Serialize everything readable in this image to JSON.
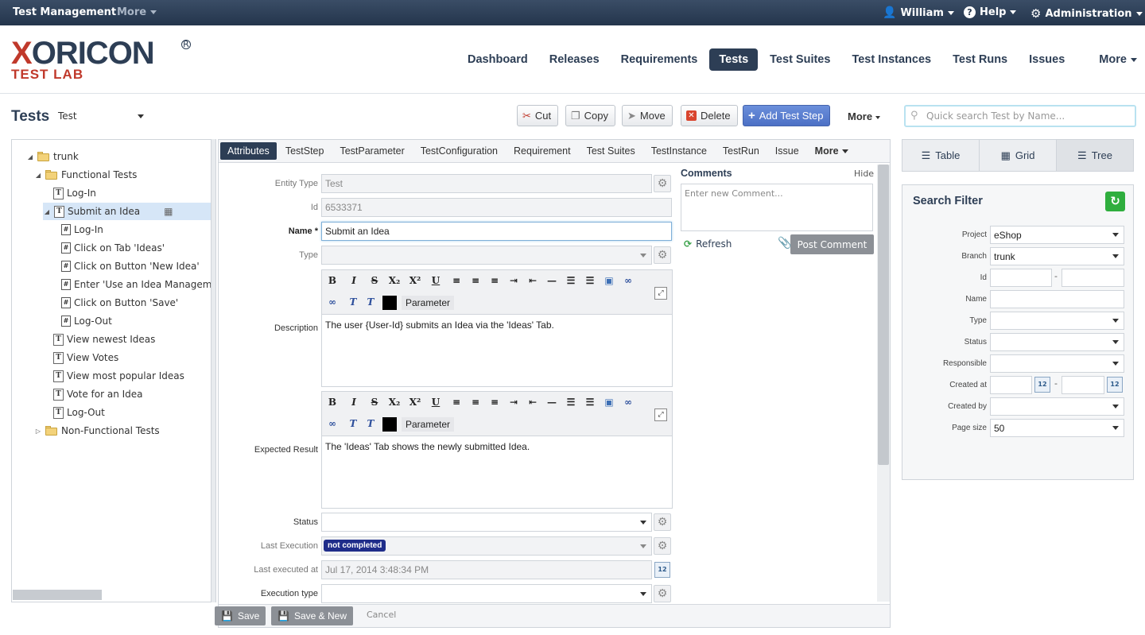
{
  "topbar": {
    "app_title": "Test Management",
    "more": "More",
    "user": "William",
    "help": "Help",
    "admin": "Administration"
  },
  "logo": {
    "line1": "XORICON",
    "line2": "TEST LAB"
  },
  "mainnav": [
    "Dashboard",
    "Releases",
    "Requirements",
    "Tests",
    "Test Suites",
    "Test Instances",
    "Test Runs",
    "Issues",
    "More"
  ],
  "page": {
    "title": "Tests",
    "type_select": "Test"
  },
  "toolbar": {
    "cut": "Cut",
    "copy": "Copy",
    "move": "Move",
    "delete": "Delete",
    "add_step": "Add Test Step",
    "more": "More"
  },
  "quick_search": {
    "placeholder": "Quick search Test by Name..."
  },
  "tree": [
    {
      "label": "trunk",
      "level": 0,
      "kind": "folder",
      "arrow": "◢"
    },
    {
      "label": "Functional Tests",
      "level": 1,
      "kind": "folder",
      "arrow": "◢"
    },
    {
      "label": "Log-In",
      "level": 2,
      "kind": "test",
      "arrow": ""
    },
    {
      "label": "Submit an Idea",
      "level": 2,
      "kind": "test",
      "arrow": "◢",
      "selected": true
    },
    {
      "label": "Log-In",
      "level": 3,
      "kind": "step",
      "arrow": ""
    },
    {
      "label": "Click on Tab 'Ideas'",
      "level": 3,
      "kind": "step",
      "arrow": ""
    },
    {
      "label": "Click on Button 'New Idea'",
      "level": 3,
      "kind": "step",
      "arrow": ""
    },
    {
      "label": "Enter 'Use an Idea Managemen",
      "level": 3,
      "kind": "step",
      "arrow": ""
    },
    {
      "label": "Click on Button 'Save'",
      "level": 3,
      "kind": "step",
      "arrow": ""
    },
    {
      "label": "Log-Out",
      "level": 3,
      "kind": "step",
      "arrow": ""
    },
    {
      "label": "View newest Ideas",
      "level": 2,
      "kind": "test",
      "arrow": ""
    },
    {
      "label": "View Votes",
      "level": 2,
      "kind": "test",
      "arrow": ""
    },
    {
      "label": "View most popular Ideas",
      "level": 2,
      "kind": "test",
      "arrow": ""
    },
    {
      "label": "Vote for an Idea",
      "level": 2,
      "kind": "test",
      "arrow": ""
    },
    {
      "label": "Log-Out",
      "level": 2,
      "kind": "test",
      "arrow": ""
    },
    {
      "label": "Non-Functional Tests",
      "level": 1,
      "kind": "folder",
      "arrow": "▷"
    }
  ],
  "tabs": [
    "Attributes",
    "TestStep",
    "TestParameter",
    "TestConfiguration",
    "Requirement",
    "Test Suites",
    "TestInstance",
    "TestRun",
    "Issue",
    "More"
  ],
  "form": {
    "entity_type_label": "Entity Type",
    "entity_type": "Test",
    "id_label": "Id",
    "id": "6533371",
    "name_label": "Name",
    "name": "Submit an Idea",
    "type_label": "Type",
    "type": "",
    "description_label": "Description",
    "description": "The user {User-Id} submits an Idea via the 'Ideas' Tab.",
    "expected_label": "Expected Result",
    "expected": "The 'Ideas' Tab shows the newly submitted Idea.",
    "parameter": "Parameter",
    "status_label": "Status",
    "status": "",
    "last_execution_label": "Last Execution",
    "last_execution": "not completed",
    "last_executed_at_label": "Last executed at",
    "last_executed_at": "Jul 17, 2014 3:48:34 PM",
    "execution_type_label": "Execution type",
    "execution_type": ""
  },
  "comments": {
    "title": "Comments",
    "hide": "Hide",
    "placeholder": "Enter new Comment...",
    "refresh": "Refresh",
    "post": "Post Comment"
  },
  "bottom": {
    "save": "Save",
    "save_new": "Save & New",
    "cancel": "Cancel"
  },
  "views": {
    "table": "Table",
    "grid": "Grid",
    "tree": "Tree"
  },
  "filter": {
    "title": "Search Filter",
    "project_label": "Project",
    "project": "eShop",
    "branch_label": "Branch",
    "branch": "trunk",
    "id_label": "Id",
    "name_label": "Name",
    "type_label": "Type",
    "status_label": "Status",
    "responsible_label": "Responsible",
    "created_at_label": "Created at",
    "created_by_label": "Created by",
    "page_size_label": "Page size",
    "page_size": "50"
  },
  "colors": {
    "navy": "#2d3e55",
    "brand_red": "#c0392b",
    "primary_btn": "#4c70c5",
    "badge": "#1f2d8a",
    "refresh_green": "#2fae3e"
  }
}
